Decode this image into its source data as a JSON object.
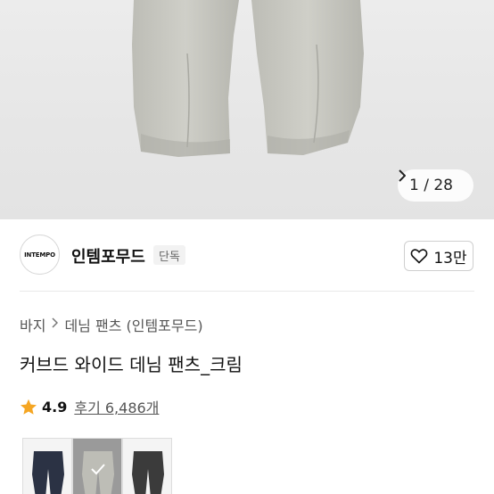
{
  "gallery": {
    "current": "1",
    "total": "28",
    "counter_text": "1 / 28"
  },
  "brand": {
    "logo_text": "INTEMPO",
    "name": "인템포무드",
    "badge": "단독"
  },
  "like": {
    "count_label": "13만"
  },
  "breadcrumb": {
    "category": "바지",
    "subcategory": "데님 팬츠 (인템포무드)"
  },
  "product": {
    "title": "커브드 와이드 데님 팬츠_크림"
  },
  "rating": {
    "score": "4.9",
    "reviews_label": "후기 6,486개"
  },
  "swatches": [
    {
      "name": "navy",
      "color": "#2b3244",
      "selected": false
    },
    {
      "name": "cream",
      "color": "#bdbdb6",
      "selected": true
    },
    {
      "name": "charcoal",
      "color": "#3b3b3b",
      "selected": false
    }
  ],
  "colors": {
    "star": "#f5a623",
    "hero_bg": "#e6e6e6"
  },
  "icons": {
    "counter_next": "chevron-right-icon",
    "like": "heart-icon",
    "breadcrumb_sep": "chevron-right-icon",
    "rating": "star-icon",
    "selected": "check-icon"
  }
}
